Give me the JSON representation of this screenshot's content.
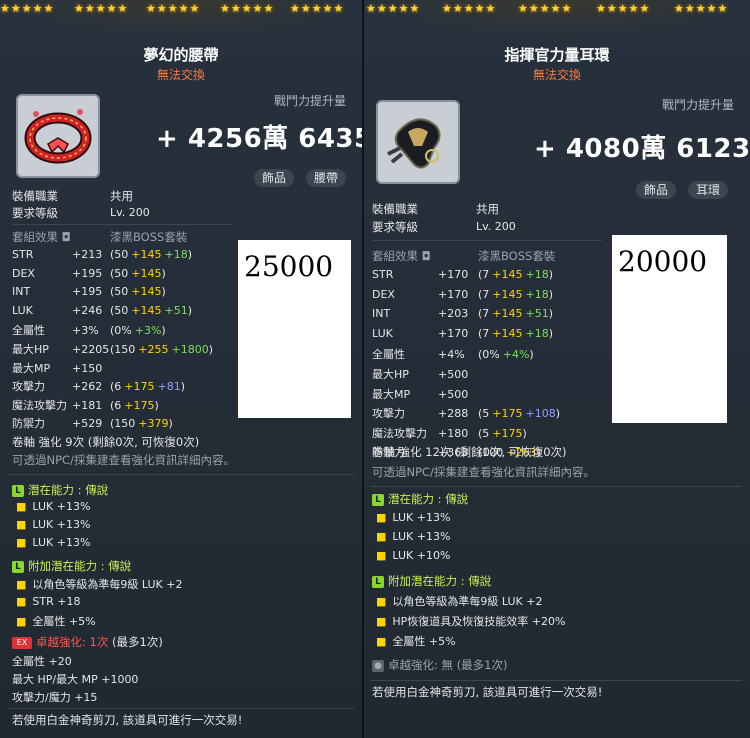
{
  "left": {
    "title": "夢幻的腰帶",
    "trade": "無法交換",
    "cp_label": "戰鬥力提升量",
    "cp_value": "+ 4256萬 6435",
    "tags": [
      "飾品",
      "腰帶"
    ],
    "job_label": "裝備職業",
    "job_value": "共用",
    "req_label": "要求等級",
    "req_value": "Lv. 200",
    "set_label": "套組效果",
    "set_value": "漆黑BOSS套裝",
    "stats": [
      {
        "name": "STR",
        "total": "+213",
        "base": "(50",
        "y": "+145",
        "g": "+18",
        "b": "",
        "close": ")"
      },
      {
        "name": "DEX",
        "total": "+195",
        "base": "(50",
        "y": "+145",
        "g": "",
        "b": "",
        "close": ")"
      },
      {
        "name": "INT",
        "total": "+195",
        "base": "(50",
        "y": "+145",
        "g": "",
        "b": "",
        "close": ")"
      },
      {
        "name": "LUK",
        "total": "+246",
        "base": "(50",
        "y": "+145",
        "g": "+51",
        "b": "",
        "close": ")"
      },
      {
        "name": "全屬性",
        "total": "+3%",
        "base": "(0%",
        "y": "",
        "g": "+3%",
        "b": "",
        "close": ")"
      },
      {
        "name": "最大HP",
        "total": "+2205",
        "base": "(150",
        "y": "+255",
        "g": "+1800",
        "b": "",
        "close": ")"
      },
      {
        "name": "最大MP",
        "total": "+150",
        "base": "",
        "y": "",
        "g": "",
        "b": "",
        "close": ""
      },
      {
        "name": "攻擊力",
        "total": "+262",
        "base": "(6",
        "y": "+175",
        "g": "",
        "b": "+81",
        "close": ")"
      },
      {
        "name": "魔法攻擊力",
        "total": "+181",
        "base": "(6",
        "y": "+175",
        "g": "",
        "b": "",
        "close": ")"
      },
      {
        "name": "防禦力",
        "total": "+529",
        "base": "(150",
        "y": "+379",
        "g": "",
        "b": "",
        "close": ")"
      }
    ],
    "box_value": "25000",
    "scroll": "卷軸 強化 9次 (剩餘0次, 可恢復0次)",
    "npc_note": "可透過NPC/採集建查看強化資訊詳細內容。",
    "pot_label": "潛在能力 :",
    "pot_grade": "傳說",
    "pot_lines": [
      "LUK +13%",
      "LUK +13%",
      "LUK +13%"
    ],
    "add_label": "附加潛在能力 :",
    "add_grade": "傳說",
    "add_lines": [
      "以角色等級為準每9級 LUK +2",
      "STR +18",
      "全屬性 +5%"
    ],
    "ex_badge": "EX",
    "ex_label": "卓越強化:",
    "ex_value": "1次",
    "ex_max": "(最多1次)",
    "ex_lines": [
      "全屬性 +20",
      "最大 HP/最大 MP +1000",
      "攻擊力/魔力 +15"
    ],
    "footer": "若使用白金神奇剪刀, 該道具可進行一次交易!"
  },
  "right": {
    "title": "指揮官力量耳環",
    "trade": "無法交換",
    "cp_label": "戰鬥力提升量",
    "cp_value": "+ 4080萬 6123",
    "tags": [
      "飾品",
      "耳環"
    ],
    "job_label": "裝備職業",
    "job_value": "共用",
    "req_label": "要求等級",
    "req_value": "Lv. 200",
    "set_label": "套組效果",
    "set_value": "漆黑BOSS套裝",
    "stats": [
      {
        "name": "STR",
        "total": "+170",
        "base": "(7",
        "y": "+145",
        "g": "+18",
        "b": "",
        "close": ")"
      },
      {
        "name": "DEX",
        "total": "+170",
        "base": "(7",
        "y": "+145",
        "g": "+18",
        "b": "",
        "close": ")"
      },
      {
        "name": "INT",
        "total": "+203",
        "base": "(7",
        "y": "+145",
        "g": "+51",
        "b": "",
        "close": ")"
      },
      {
        "name": "LUK",
        "total": "+170",
        "base": "(7",
        "y": "+145",
        "g": "+18",
        "b": "",
        "close": ")"
      },
      {
        "name": "全屬性",
        "total": "+4%",
        "base": "(0%",
        "y": "",
        "g": "+4%",
        "b": "",
        "close": ")"
      },
      {
        "name": "最大HP",
        "total": "+500",
        "base": "",
        "y": "",
        "g": "",
        "b": "",
        "close": ""
      },
      {
        "name": "最大MP",
        "total": "+500",
        "base": "",
        "y": "",
        "g": "",
        "b": "",
        "close": ""
      },
      {
        "name": "攻擊力",
        "total": "+288",
        "base": "(5",
        "y": "+175",
        "g": "",
        "b": "+108",
        "close": ")"
      },
      {
        "name": "魔法攻擊力",
        "total": "+180",
        "base": "(5",
        "y": "+175",
        "g": "",
        "b": "",
        "close": ")"
      },
      {
        "name": "防禦力",
        "total": "+363",
        "base": "(100",
        "y": "+263",
        "g": "",
        "b": "",
        "close": ")"
      }
    ],
    "box_value": "20000",
    "scroll": "卷軸 強化 12次 (剩餘0次, 可恢復0次)",
    "npc_note": "可透過NPC/採集建查看強化資訊詳細內容。",
    "pot_label": "潛在能力 :",
    "pot_grade": "傳說",
    "pot_lines": [
      "LUK +13%",
      "LUK +13%",
      "LUK +10%"
    ],
    "add_label": "附加潛在能力 :",
    "add_grade": "傳說",
    "add_lines": [
      "以角色等級為準每9級 LUK +2",
      "HP恢復道具及恢復技能效率 +20%",
      "全屬性 +5%"
    ],
    "ex_label": "卓越強化:",
    "ex_value": "無",
    "ex_max": "(最多1次)",
    "footer": "若使用白金神奇剪刀, 該道具可進行一次交易!"
  },
  "colors": {
    "potential": "#c8f050",
    "bonus": "#ffd400",
    "enhance": "#7be05a",
    "extra": "#8fa0ff",
    "trade": "#ff7a3a"
  }
}
